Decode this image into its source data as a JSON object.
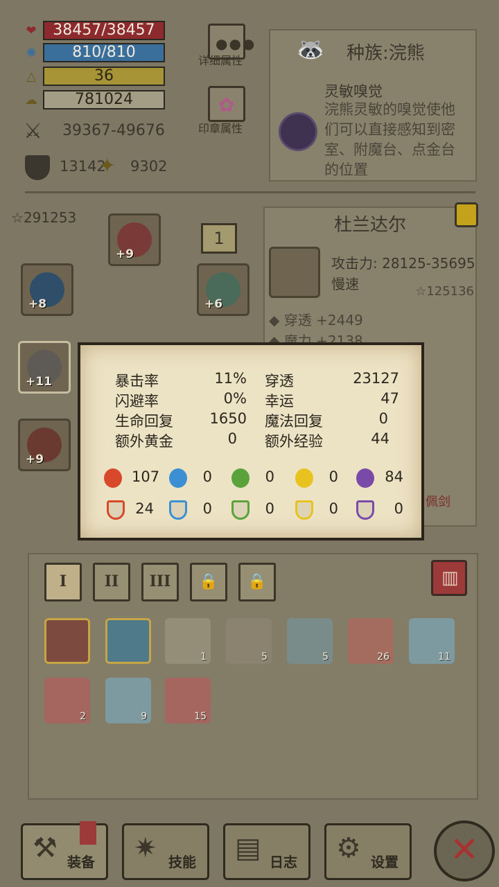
{
  "stats": {
    "hp": "38457/38457",
    "mp": "810/810",
    "level": "36",
    "gold": "781024",
    "attack": "39367-49676",
    "defense": "13142",
    "magic_power": "9302"
  },
  "buttons": {
    "detail_attr": "详细属性",
    "seal_attr": "印章属性"
  },
  "race": {
    "title": "种族:浣熊",
    "skill_name": "灵敏嗅觉",
    "skill_desc_lines": [
      "浣熊灵敏的嗅觉使他",
      "们可以直接感知到密",
      "室、附魔台、点金台",
      "的位置"
    ]
  },
  "equip": {
    "score": "291253",
    "slot_counter": "1",
    "slot_levels": [
      "+9",
      "+8",
      "+6",
      "+11",
      "+9"
    ]
  },
  "weapon": {
    "name": "杜兰达尔",
    "attack": "攻击力: 28125-35695",
    "speed": "慢速",
    "score": "125136",
    "attr1": "穿透 +2449",
    "attr2": "魔力 +2138",
    "type_partial": "佩剑"
  },
  "popup": {
    "rows": [
      {
        "l_label": "暴击率",
        "l_val": "11%",
        "r_label": "穿透",
        "r_val": "23127"
      },
      {
        "l_label": "闪避率",
        "l_val": "0%",
        "r_label": "幸运",
        "r_val": "47"
      },
      {
        "l_label": "生命回复",
        "l_val": "1650",
        "r_label": "魔法回复",
        "r_val": "0"
      },
      {
        "l_label": "额外黄金",
        "l_val": "0",
        "r_label": "额外经验",
        "r_val": "44"
      }
    ],
    "attack_elements": [
      "107",
      "0",
      "0",
      "0",
      "84"
    ],
    "defense_elements": [
      "24",
      "0",
      "0",
      "0",
      "0"
    ]
  },
  "tabs": [
    "I",
    "II",
    "III"
  ],
  "inventory": {
    "row1_counts": [
      "",
      "",
      "1",
      "5",
      "5",
      "26",
      "11"
    ],
    "row2_counts": [
      "2",
      "9",
      "15"
    ]
  },
  "nav": {
    "equip": "装备",
    "skills": "技能",
    "log": "日志",
    "settings": "设置"
  },
  "colors": {
    "hp_bar": "#8c2a2e",
    "mp_bar": "#3a6f9c",
    "level_bar": "#b6a33a",
    "gold_bar": "#c8bf9e",
    "fire": "#d8482a",
    "water": "#3c8fd2",
    "nature": "#5aa23c",
    "light": "#e8c21e",
    "dark": "#7a4aa8"
  }
}
